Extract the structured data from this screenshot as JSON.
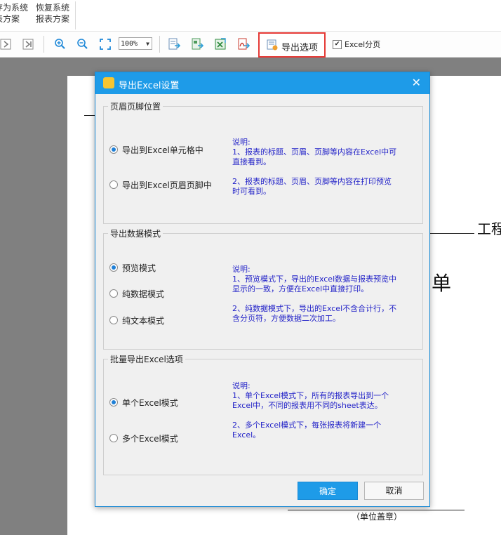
{
  "menu": {
    "items": [
      {
        "line1": "存为系统",
        "line2": "表方案"
      },
      {
        "line1": "恢复系统",
        "line2": "报表方案"
      }
    ]
  },
  "toolbar": {
    "zoom": "100%",
    "export_options_label": "导出选项",
    "excel_paging_label": "Excel分页",
    "excel_paging_checked": true,
    "highlight_color": "#e53935"
  },
  "background_report": {
    "engineering_text": "工程",
    "single_char": "单",
    "seal_label": "（单位盖章）"
  },
  "dialog": {
    "title": "导出Excel设置",
    "title_bar_color": "#1e9be8",
    "group1": {
      "title": "页眉页脚位置",
      "options": [
        "导出到Excel单元格中",
        "导出到Excel页眉页脚中"
      ],
      "selected_index": 0,
      "desc_head": "说明:",
      "desc_lines": [
        "  1、报表的标题、页眉、页脚等内容在Excel中可",
        "直接看到。",
        "",
        "  2、报表的标题、页眉、页脚等内容在打印预览",
        "时可看到。"
      ]
    },
    "group2": {
      "title": "导出数据模式",
      "options": [
        "预览模式",
        "纯数据模式",
        "纯文本模式"
      ],
      "selected_index": 0,
      "desc_head": "说明:",
      "desc_lines": [
        "  1、预览模式下，导出的Excel数据与报表预览中",
        "显示的一致，方便在Excel中直接打印。",
        "",
        "  2、纯数据模式下，导出的Excel不含合计行，不",
        "含分页符，方便数据二次加工。"
      ]
    },
    "group3": {
      "title": "批量导出Excel选项",
      "options": [
        "单个Excel模式",
        "多个Excel模式"
      ],
      "selected_index": 0,
      "desc_head": "说明:",
      "desc_lines": [
        "  1、单个Excel模式下，所有的报表导出到一个",
        "Excel中，不同的报表用不同的sheet表达。",
        "",
        "  2、多个Excel模式下，每张报表将新建一个",
        "Excel。"
      ]
    },
    "ok_label": "确定",
    "cancel_label": "取消"
  }
}
